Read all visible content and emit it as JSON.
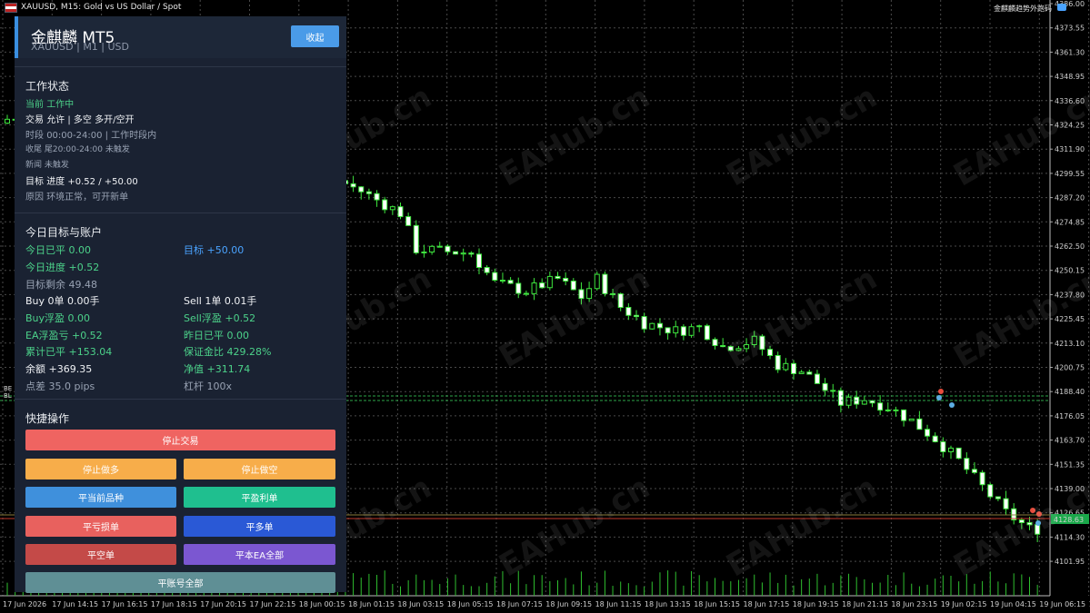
{
  "window": {
    "symbol_title": "XAUUSD, M15:  Gold vs US Dollar / Spot",
    "ea_tag": "金麒麟趋势外跑码"
  },
  "watermark": "EAHub.cn",
  "price_axis": {
    "labels": [
      "4386.00",
      "4373.55",
      "4361.30",
      "4348.95",
      "4336.60",
      "4324.25",
      "4311.90",
      "4299.55",
      "4287.20",
      "4274.85",
      "4262.50",
      "4250.15",
      "4237.80",
      "4225.45",
      "4213.10",
      "4200.75",
      "4188.40",
      "4176.05",
      "4163.70",
      "4151.35",
      "4139.00",
      "4126.65",
      "4114.30",
      "4101.95"
    ],
    "current_price": "4128.63"
  },
  "time_axis": {
    "labels": [
      "17 Jun 2026",
      "17 Jun 14:15",
      "17 Jun 16:15",
      "17 Jun 18:15",
      "17 Jun 20:15",
      "17 Jun 22:15",
      "18 Jun 00:15",
      "18 Jun 01:15",
      "18 Jun 03:15",
      "18 Jun 05:15",
      "18 Jun 07:15",
      "18 Jun 09:15",
      "18 Jun 11:15",
      "18 Jun 13:15",
      "18 Jun 15:15",
      "18 Jun 17:15",
      "18 Jun 19:15",
      "18 Jun 21:15",
      "18 Jun 23:15",
      "19 Jun 02:15",
      "19 Jun 04:15",
      "19 Jun 06:15",
      "19 Jun 08:15"
    ]
  },
  "left_labels": [
    "BE",
    "BL"
  ],
  "panel": {
    "title": "金麒麟 MT5",
    "subtitle": "XAUUSD  |  M1  |  USD",
    "collapse_label": "收起",
    "status": {
      "heading": "工作状态",
      "current": {
        "label": "当前",
        "value": "工作中"
      },
      "trade": {
        "label": "交易",
        "value": "允许  |  多空  多开/空开"
      },
      "session": {
        "label": "时段",
        "value": "00:00-24:00  |  工作时段内"
      },
      "close": {
        "label": "收尾",
        "value": "尾20:00-24:00 未触发"
      },
      "news": {
        "label": "新闻",
        "value": "未触发"
      },
      "target": {
        "label": "目标",
        "value": "进度 +0.52 / +50.00"
      },
      "reason": {
        "label": "原因",
        "value": "环境正常，可开新单"
      }
    },
    "account": {
      "heading": "今日目标与账户",
      "rows": [
        {
          "l": "今日已平  0.00",
          "r": "目标  +50.00"
        },
        {
          "l": "今日进度  +0.52",
          "r": ""
        },
        {
          "l": "目标剩余  49.48",
          "r": ""
        },
        {
          "l": "Buy  0单  0.00手",
          "r": "Sell  1单  0.01手"
        },
        {
          "l": "Buy浮盈  0.00",
          "r": "Sell浮盈  +0.52"
        },
        {
          "l": "EA浮盈亏  +0.52",
          "r": "昨日已平  0.00"
        },
        {
          "l": "累计已平  +153.04",
          "r": "保证金比  429.28%"
        },
        {
          "l": "余额  +369.35",
          "r": "净值  +311.74"
        },
        {
          "l": "点差  35.0 pips",
          "r": "杠杆  100x"
        }
      ]
    },
    "quick": {
      "heading": "快捷操作",
      "stop_trading": "停止交易",
      "stop_long": "停止做多",
      "stop_short": "停止做空",
      "close_symbol": "平当前品种",
      "close_profit": "平盈利单",
      "close_loss": "平亏损单",
      "close_buy": "平多单",
      "close_sell": "平空单",
      "close_ea_all": "平本EA全部",
      "close_account_all": "平账号全部"
    }
  },
  "chart_data": {
    "type": "candlestick",
    "symbol": "XAUUSD",
    "timeframe": "M15",
    "ylim": [
      4098,
      4388
    ],
    "close_path": [
      [
        0,
        4332
      ],
      [
        4,
        4333
      ],
      [
        12,
        4318
      ],
      [
        18,
        4326
      ],
      [
        22,
        4320
      ],
      [
        27,
        4319
      ],
      [
        32,
        4308
      ],
      [
        35,
        4298
      ],
      [
        39,
        4307
      ],
      [
        45,
        4296
      ],
      [
        50,
        4285
      ],
      [
        52,
        4267
      ],
      [
        55,
        4266
      ],
      [
        59,
        4265
      ],
      [
        62,
        4250
      ],
      [
        66,
        4246
      ],
      [
        70,
        4252
      ],
      [
        73,
        4243
      ],
      [
        75,
        4252
      ],
      [
        78,
        4238
      ],
      [
        81,
        4230
      ],
      [
        85,
        4226
      ],
      [
        88,
        4228
      ],
      [
        91,
        4218
      ],
      [
        95,
        4221
      ],
      [
        98,
        4209
      ],
      [
        101,
        4206
      ],
      [
        103,
        4200
      ],
      [
        106,
        4190
      ],
      [
        109,
        4192
      ],
      [
        112,
        4188
      ],
      [
        115,
        4181
      ],
      [
        118,
        4172
      ],
      [
        121,
        4161
      ],
      [
        124,
        4148
      ],
      [
        127,
        4135
      ],
      [
        130,
        4127
      ]
    ]
  }
}
